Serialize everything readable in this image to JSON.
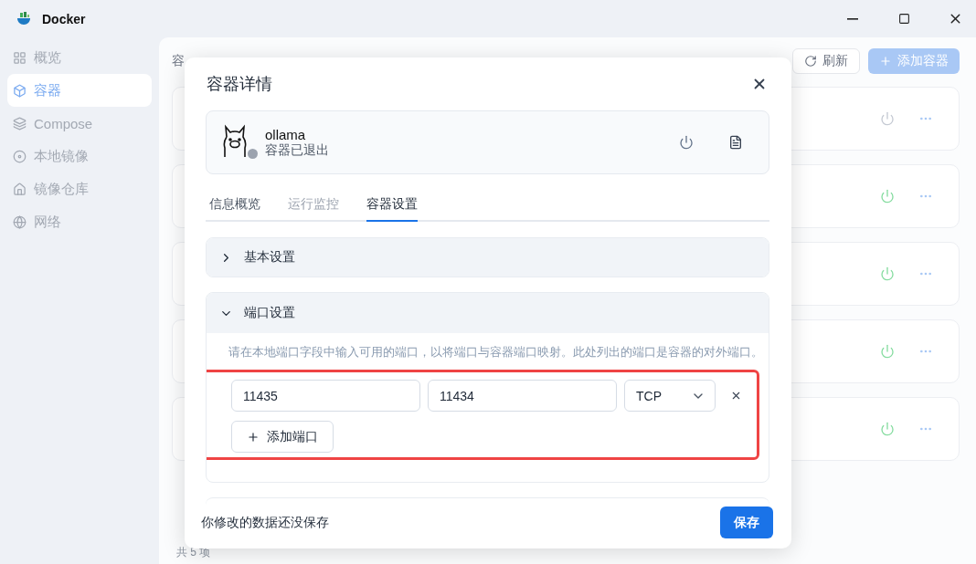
{
  "window": {
    "title": "Docker"
  },
  "sidebar": {
    "items": [
      {
        "label": "概览",
        "selected": false
      },
      {
        "label": "容器",
        "selected": true
      },
      {
        "label": "Compose",
        "selected": false
      },
      {
        "label": "本地镜像",
        "selected": false
      },
      {
        "label": "镜像仓库",
        "selected": false
      },
      {
        "label": "网络",
        "selected": false
      }
    ]
  },
  "main": {
    "heading": "容",
    "refresh_button": "刷新",
    "add_button": "添加容器",
    "containers": [
      {
        "running": false
      },
      {
        "running": true
      },
      {
        "running": true
      },
      {
        "running": true
      },
      {
        "running": true
      }
    ],
    "footer": "共 5 项"
  },
  "dialog": {
    "title": "容器详情",
    "container": {
      "name": "ollama",
      "status": "容器已退出",
      "running": false
    },
    "tabs": [
      {
        "label": "信息概览",
        "selected": false,
        "disabled": false
      },
      {
        "label": "运行监控",
        "selected": false,
        "disabled": true
      },
      {
        "label": "容器设置",
        "selected": true,
        "disabled": false
      }
    ],
    "sections": [
      {
        "title": "基本设置",
        "expanded": false
      },
      {
        "title": "端口设置",
        "expanded": true,
        "hint": "请在本地端口字段中输入可用的端口，以将端口与容器端口映射。此处列出的端口是容器的对外端口。",
        "ports": [
          {
            "local": "11435",
            "container": "11434",
            "protocol": "TCP"
          }
        ],
        "add_button": "添加端口"
      }
    ],
    "footer": {
      "message": "你修改的数据还没保存",
      "save_button": "保存"
    }
  }
}
